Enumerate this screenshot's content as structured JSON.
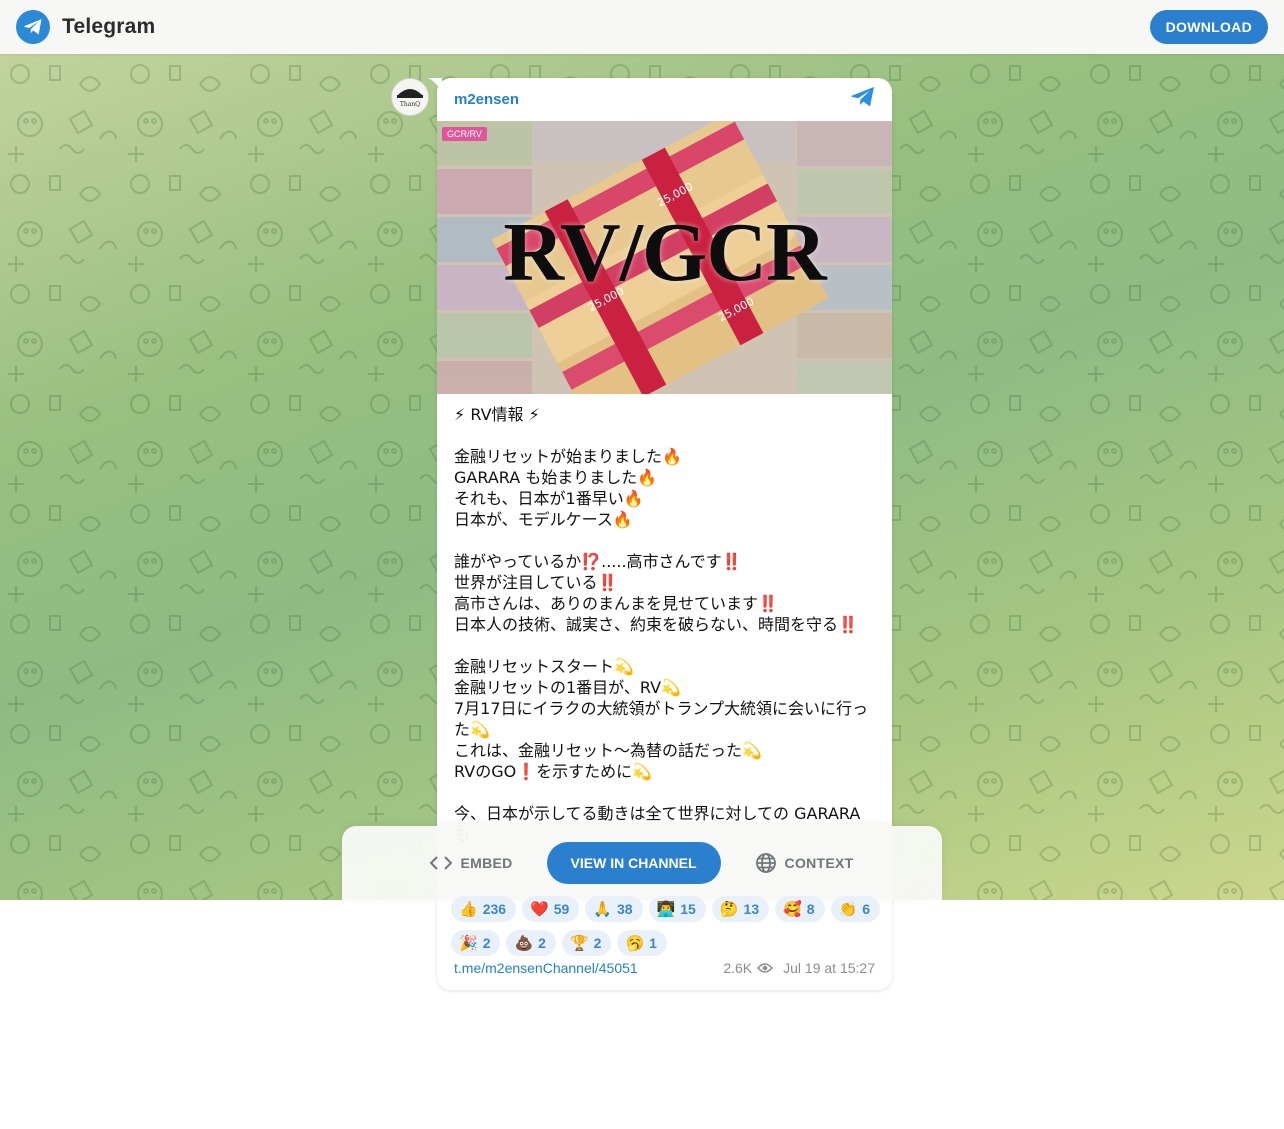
{
  "header": {
    "brand": "Telegram",
    "download_label": "DOWNLOAD"
  },
  "post": {
    "channel_name": "m2ensen",
    "avatar_text": "ThanQ",
    "image_tag": "GCR/RV",
    "image_title": "RV/GCR",
    "lines": [
      "⚡ RV情報 ⚡",
      "",
      "金融リセットが始まりました🔥",
      "GARARA も始まりました🔥",
      "それも、日本が1番早い🔥",
      "日本が、モデルケース🔥",
      "",
      "誰がやっているか⁉️.....高市さんです‼️",
      "世界が注目している‼️",
      "高市さんは、ありのまんまを見せています‼️",
      "日本人の技術、誠実さ、約束を破らない、時間を守る‼️",
      "",
      "金融リセットスタート💫",
      "金融リセットの1番目が、RV💫",
      "7月17日にイラクの大統領がトランプ大統領に会いに行った💫",
      "これは、金融リセット〜為替の話だった💫",
      "RVのGO❗️を示すために💫",
      "",
      "今、日本が示してる動きは全て世界に対しての GARARA も"
    ],
    "reactions": [
      {
        "emoji": "👍",
        "count": "236"
      },
      {
        "emoji": "❤️",
        "count": "59"
      },
      {
        "emoji": "🙏",
        "count": "38"
      },
      {
        "emoji": "👨‍💻",
        "count": "15"
      },
      {
        "emoji": "🤔",
        "count": "13"
      },
      {
        "emoji": "🥰",
        "count": "8"
      },
      {
        "emoji": "👏",
        "count": "6"
      },
      {
        "emoji": "🎉",
        "count": "2"
      },
      {
        "emoji": "💩",
        "count": "2"
      },
      {
        "emoji": "🏆",
        "count": "2"
      },
      {
        "emoji": "🥱",
        "count": "1"
      }
    ],
    "link": "t.me/m2ensenChannel/45051",
    "views": "2.6K",
    "date": "Jul 19 at 15:27"
  },
  "actions": {
    "embed_label": "EMBED",
    "view_label": "VIEW IN CHANNEL",
    "context_label": "CONTEXT"
  },
  "colors": {
    "accent": "#2b7fcf",
    "link": "#2481cc",
    "reaction_bg": "#e8f1fa"
  }
}
